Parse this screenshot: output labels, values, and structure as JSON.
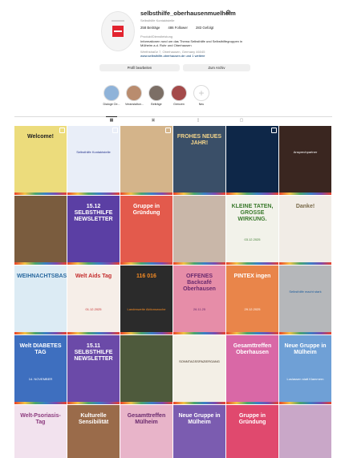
{
  "profile": {
    "username": "selbsthilfe_oberhausenmuelheim",
    "subname": "Selbsthilfe Kontaktstelle",
    "stats": {
      "posts": "258 Beiträge",
      "followers": "486 Follower",
      "following": "283 Gefolgt"
    },
    "category": "Produkt/Dienstleistung",
    "bio_line1": "Informationen rund um das Thema Selbsthilfe und Selbsthilfegruppen in",
    "bio_line2": "Mülheim a.d. Ruhr und Oberhausen",
    "location": "Werthstraße 7, Oberhausen, Germany 46045",
    "link": "www.selbsthilfe-oberhausen.de und 1 weitere",
    "settings_icon": "settings-gear-icon",
    "edit_button": "Profil bearbeiten",
    "archive_button": "Zum Archiv"
  },
  "highlights": [
    {
      "label": "Dialoge Oe...",
      "color": "#8fb3d9"
    },
    {
      "label": "Veranstaltun...",
      "color": "#b98c6e"
    },
    {
      "label": "Beiträge",
      "color": "#7c6f66"
    },
    {
      "label": "Grenzen",
      "color": "#a44a4a"
    },
    {
      "label": "Neu",
      "color": "#ffffff"
    }
  ],
  "tabs": [
    {
      "icon": "grid-icon",
      "glyph": "▦",
      "active": true
    },
    {
      "icon": "reels-icon",
      "glyph": "▣",
      "active": false
    },
    {
      "icon": "saved-icon",
      "glyph": "▯",
      "active": false
    },
    {
      "icon": "tagged-icon",
      "glyph": "▢",
      "active": false
    }
  ],
  "posts": [
    {
      "title": "Welcome!",
      "sub": "",
      "bg": "#ecdc7c",
      "fg": "#222222",
      "pin": true
    },
    {
      "title": "",
      "sub": "Selbsthilfe Kontaktstelle",
      "bg": "#e9eef8",
      "fg": "#25348c",
      "pin": true
    },
    {
      "title": "",
      "sub": "",
      "bg": "#d4b48a",
      "fg": "#3a2a1a",
      "pin": true
    },
    {
      "title": "FROHES NEUES JAHR!",
      "sub": "",
      "bg": "#3a4f68",
      "fg": "#f4d58b",
      "pin": false
    },
    {
      "title": "",
      "sub": "",
      "bg": "#0e2748",
      "fg": "#ffffff",
      "pin": true
    },
    {
      "title": "",
      "sub": "Ansprechpartner",
      "bg": "#3a2620",
      "fg": "#ffffff",
      "pin": false
    },
    {
      "title": "",
      "sub": "",
      "bg": "#7a5c3e",
      "fg": "#ffffff",
      "pin": false
    },
    {
      "title": "15.12 SELBSTHILFE NEWSLETTER",
      "sub": "",
      "bg": "#5b3fa4",
      "fg": "#ffffff",
      "pin": false
    },
    {
      "title": "Gruppe in Gründung",
      "sub": "",
      "bg": "#e35a4c",
      "fg": "#ffffff",
      "pin": false
    },
    {
      "title": "",
      "sub": "",
      "bg": "#c9b7a9",
      "fg": "#3a2a1a",
      "pin": false
    },
    {
      "title": "KLEINE TATEN, GROSSE WIRKUNG.",
      "sub": "03.12.2025",
      "bg": "#f2f2ea",
      "fg": "#3b7a2d",
      "pin": false
    },
    {
      "title": "Danke!",
      "sub": "",
      "bg": "#f1ece6",
      "fg": "#7a6a4a",
      "pin": false
    },
    {
      "title": "WEIHNACHTSBASTELN",
      "sub": "",
      "bg": "#dcebf4",
      "fg": "#2b6aa0",
      "pin": false
    },
    {
      "title": "Welt Aids Tag",
      "sub": "01.12.2025",
      "bg": "#f6eee8",
      "fg": "#c42c2c",
      "pin": false
    },
    {
      "title": "116 016",
      "sub": "Landesweite Aktionswoche",
      "bg": "#2b2b2b",
      "fg": "#f28a24",
      "pin": false
    },
    {
      "title": "OFFENES Backcafé Oberhausen",
      "sub": "26.11.25",
      "bg": "#e68da8",
      "fg": "#6a2a6e",
      "pin": false
    },
    {
      "title": "PINTEX ingen",
      "sub": "29.12.2025",
      "bg": "#e9854a",
      "fg": "#ffffff",
      "pin": false
    },
    {
      "title": "",
      "sub": "Selbsthilfe macht stark",
      "bg": "#b5b7ba",
      "fg": "#1b5b9c",
      "pin": false
    },
    {
      "title": "Welt DIABETES TAG",
      "sub": "14. NOVEMBER",
      "bg": "#3e6fbf",
      "fg": "#ffffff",
      "pin": false
    },
    {
      "title": "15.11 SELBSTHILFE NEWSLETTER",
      "sub": "",
      "bg": "#6b4aa8",
      "fg": "#ffffff",
      "pin": false
    },
    {
      "title": "",
      "sub": "",
      "bg": "#4e5a3c",
      "fg": "#ffffff",
      "pin": false
    },
    {
      "title": "",
      "sub": "SONNTAGSSPAZIERGANG",
      "bg": "#f3efe6",
      "fg": "#3a2a1a",
      "pin": false
    },
    {
      "title": "Gesamttreffen Oberhausen",
      "sub": "",
      "bg": "#d968a6",
      "fg": "#ffffff",
      "pin": false
    },
    {
      "title": "Neue Gruppe in Mülheim",
      "sub": "Loslassen statt Klammern",
      "bg": "#6fa0d6",
      "fg": "#ffffff",
      "pin": false
    },
    {
      "title": "Welt-Psoriasis-Tag",
      "sub": "",
      "bg": "#f2e2ee",
      "fg": "#8c3a7e",
      "pin": false
    },
    {
      "title": "Kulturelle Sensibilität",
      "sub": "",
      "bg": "#9a6b4a",
      "fg": "#ffffff",
      "pin": false
    },
    {
      "title": "Gesamttreffen Mülheim",
      "sub": "",
      "bg": "#e8b4c9",
      "fg": "#6a2a6e",
      "pin": false
    },
    {
      "title": "Neue Gruppe in Mülheim",
      "sub": "",
      "bg": "#7b5cb0",
      "fg": "#ffffff",
      "pin": false
    },
    {
      "title": "Gruppe in Gründung",
      "sub": "",
      "bg": "#e0496e",
      "fg": "#ffffff",
      "pin": false
    },
    {
      "title": "",
      "sub": "",
      "bg": "#c9a7c8",
      "fg": "#4a2a4a",
      "pin": false
    }
  ]
}
